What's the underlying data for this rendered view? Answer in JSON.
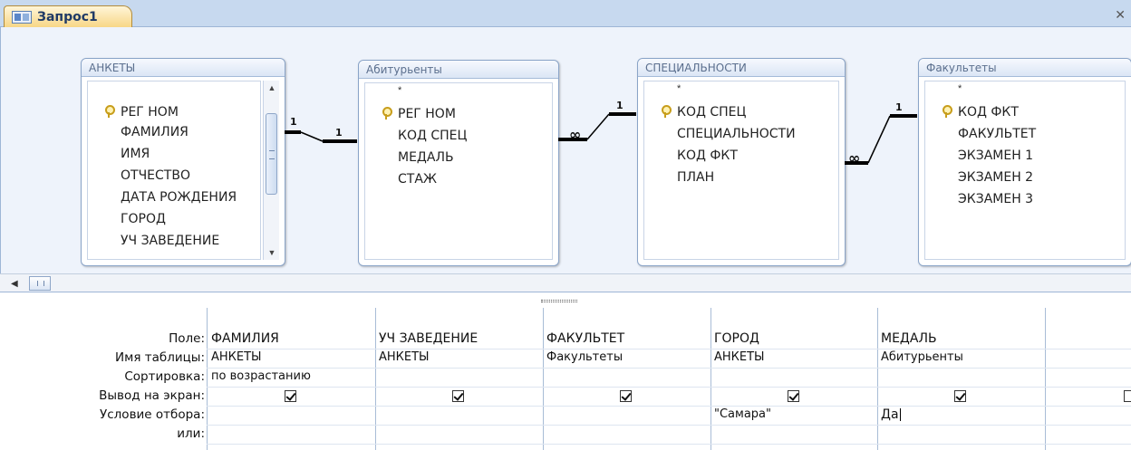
{
  "tab": {
    "label": "Запрос1"
  },
  "tables": [
    {
      "title": "АНКЕТЫ",
      "fields": [
        "РЕГ НОМ",
        "ФАМИЛИЯ",
        "ИМЯ",
        "ОТЧЕСТВО",
        "ДАТА РОЖДЕНИЯ",
        "ГОРОД",
        "УЧ ЗАВЕДЕНИЕ"
      ]
    },
    {
      "title": "Абитурьенты",
      "star": "*",
      "fields": [
        "РЕГ НОМ",
        "КОД СПЕЦ",
        "МЕДАЛЬ",
        "СТАЖ"
      ]
    },
    {
      "title": "СПЕЦИАЛЬНОСТИ",
      "star": "*",
      "fields": [
        "КОД СПЕЦ",
        "СПЕЦИАЛЬНОСТИ",
        "КОД ФКТ",
        "ПЛАН"
      ]
    },
    {
      "title": "Факультеты",
      "star": "*",
      "fields": [
        "КОД ФКТ",
        "ФАКУЛЬТЕТ",
        "ЭКЗАМЕН 1",
        "ЭКЗАМЕН 2",
        "ЭКЗАМЕН 3"
      ]
    }
  ],
  "relations": [
    {
      "one": "1",
      "many": "1"
    },
    {
      "one": "1",
      "many": "∞"
    },
    {
      "one": "1",
      "many": "∞"
    }
  ],
  "grid": {
    "row_labels": [
      "Поле:",
      "Имя таблицы:",
      "Сортировка:",
      "Вывод на экран:",
      "Условие отбора:",
      "или:"
    ],
    "columns": [
      {
        "field": "ФАМИЛИЯ",
        "table": "АНКЕТЫ",
        "sort": "по возрастанию",
        "show": true,
        "criteria": "",
        "or": ""
      },
      {
        "field": "УЧ ЗАВЕДЕНИЕ",
        "table": "АНКЕТЫ",
        "sort": "",
        "show": true,
        "criteria": "",
        "or": ""
      },
      {
        "field": "ФАКУЛЬТЕТ",
        "table": "Факультеты",
        "sort": "",
        "show": true,
        "criteria": "",
        "or": ""
      },
      {
        "field": "ГОРОД",
        "table": "АНКЕТЫ",
        "sort": "",
        "show": true,
        "criteria": "\"Самара\"",
        "or": ""
      },
      {
        "field": "МЕДАЛЬ",
        "table": "Абитурьенты",
        "sort": "",
        "show": true,
        "criteria": "Да",
        "or": ""
      },
      {
        "field": "",
        "table": "",
        "sort": "",
        "show": true,
        "criteria": "",
        "or": ""
      }
    ]
  }
}
